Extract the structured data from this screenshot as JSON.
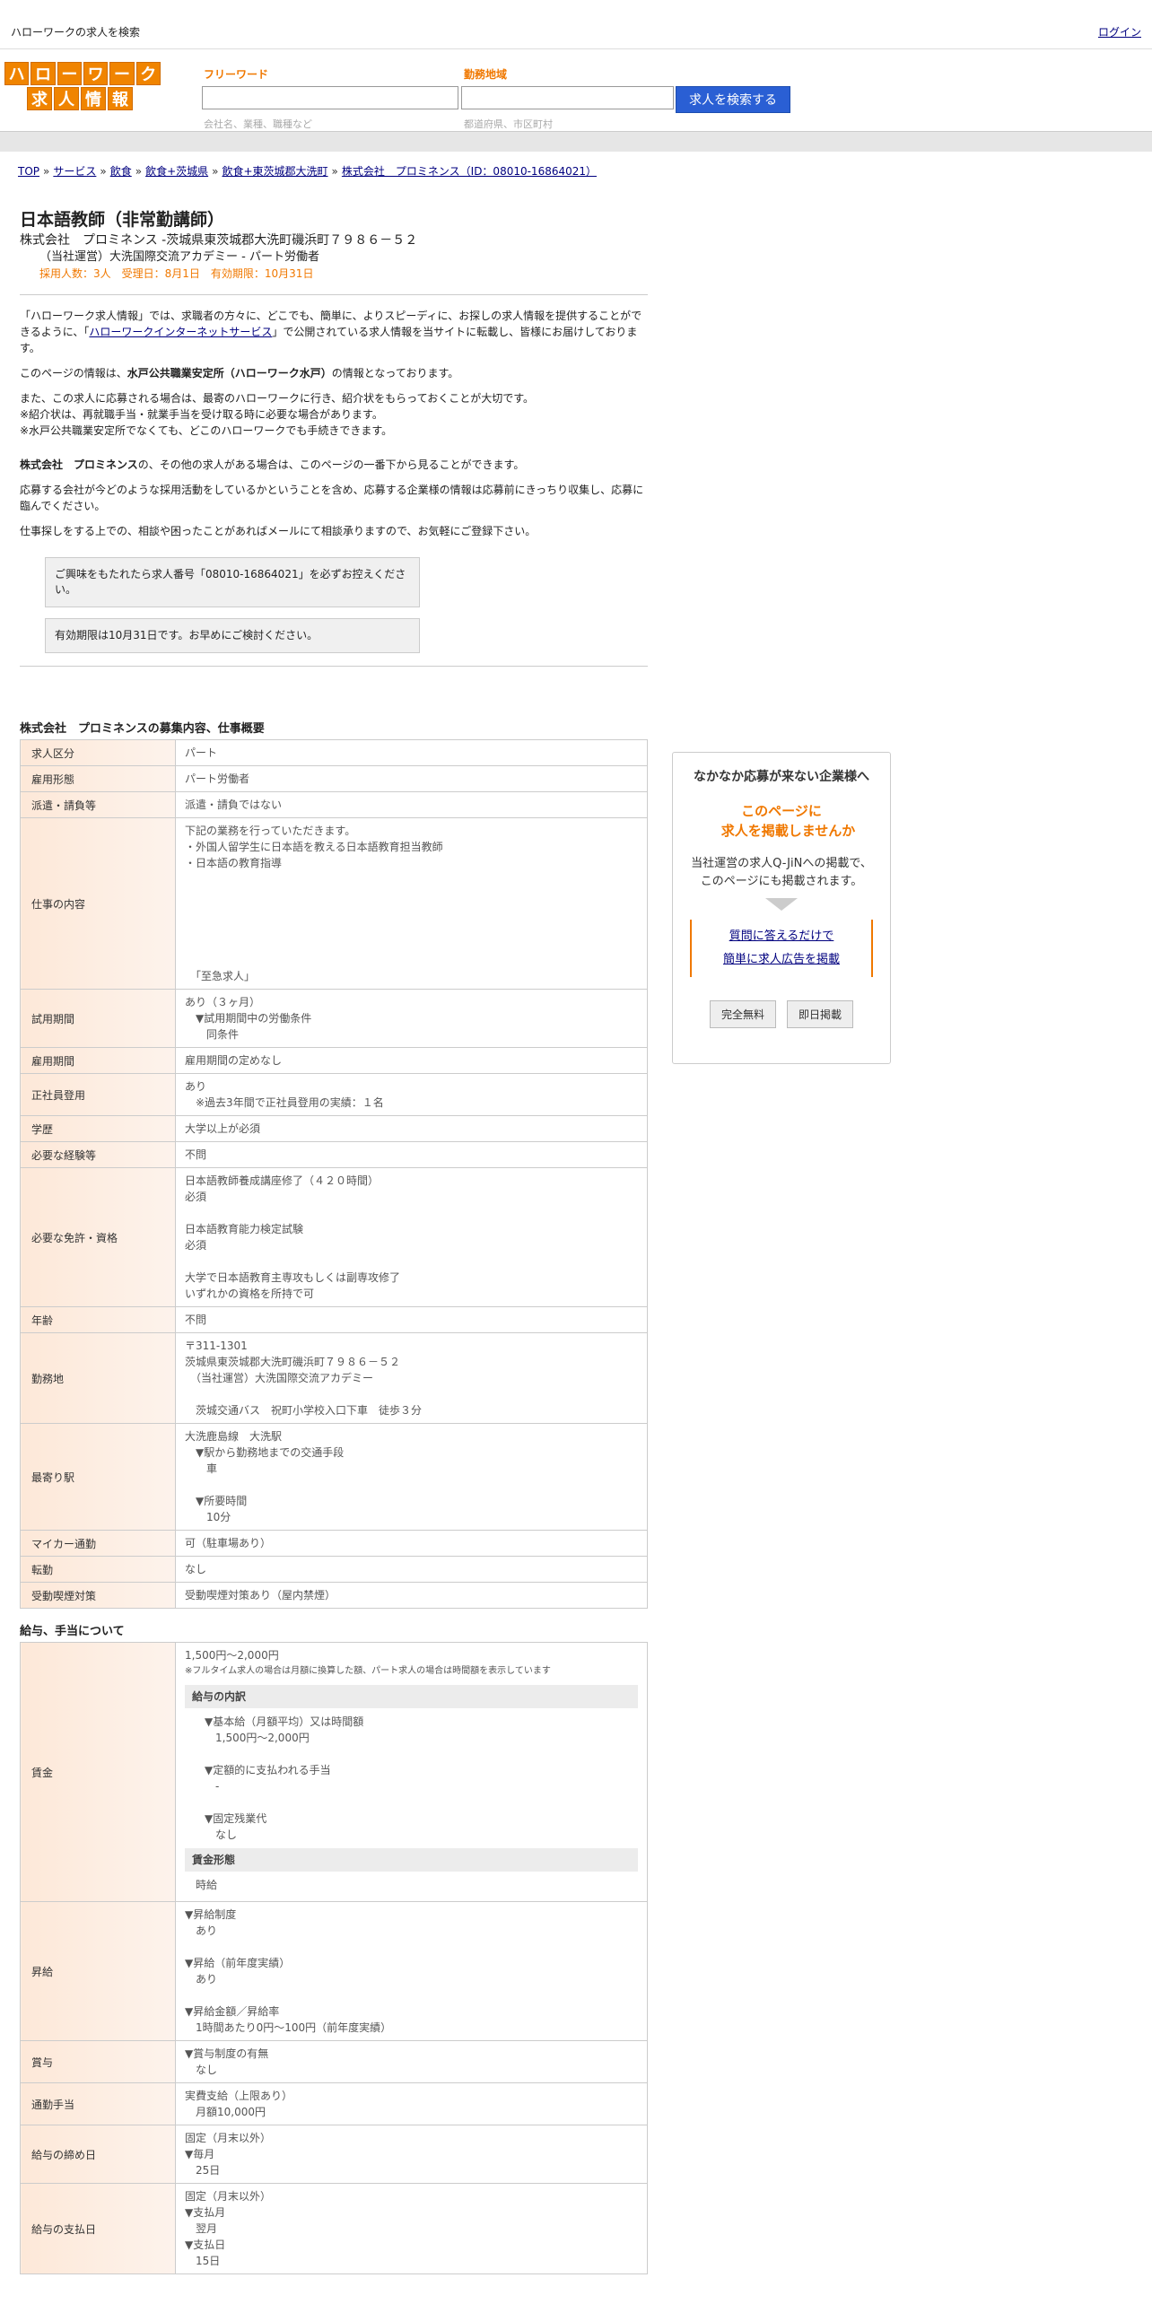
{
  "header": {
    "site_title": "ハローワークの求人を検索",
    "login": "ログイン"
  },
  "logo": {
    "row1": [
      "ハ",
      "ロ",
      "ー",
      "ワ",
      "ー",
      "ク"
    ],
    "row2": [
      "求",
      "人",
      "情",
      "報"
    ]
  },
  "search": {
    "freeword_label": "フリーワード",
    "freeword_placeholder": "会社名、業種、職種など",
    "area_label": "勤務地域",
    "area_placeholder": "都道府県、市区町村",
    "button": "求人を検索する"
  },
  "breadcrumb": [
    "TOP",
    "サービス",
    "飲食",
    "飲食+茨城県",
    "飲食+東茨城郡大洗町",
    "株式会社　プロミネンス（ID：08010-16864021）"
  ],
  "job": {
    "title": "日本語教師（非常勤講師）",
    "company_line": "株式会社　プロミネンス -茨城県東茨城郡大洗町磯浜町７９８６－５２",
    "sub_line": "（当社運営）大洗国際交流アカデミー - パート労働者",
    "meta_line": "採用人数：3人　受理日：8月1日　有効期限：10月31日"
  },
  "intro": {
    "p1": "「ハローワーク求人情報」では、求職者の方々に、どこでも、簡単に、よりスピーディに、お探しの求人情報を提供することができるように、「ハローワークインターネットサービス」で公開されている求人情報を当サイトに転載し、皆様にお届けしております。",
    "p2_pre": "このページの情報は、",
    "p2_bold": "水戸公共職業安定所（ハローワーク水戸）",
    "p2_post": "の情報となっております。",
    "p3": "また、この求人に応募される場合は、最寄のハローワークに行き、紹介状をもらっておくことが大切です。\n※紹介状は、再就職手当・就業手当を受け取る時に必要な場合があります。\n※水戸公共職業安定所でなくても、どこのハローワークでも手続きできます。",
    "p4_bold": "株式会社　プロミネンス",
    "p4_post": "の、その他の求人がある場合は、このページの一番下から見ることができます。",
    "p5": "応募する会社が今どのような採用活動をしているかということを含め、応募する企業様の情報は応募前にきっちり収集し、応募に臨んでください。",
    "p6": "仕事探しをする上での、相談や困ったことがあればメールにて相談承りますので、お気軽にご登録下さい。",
    "note1": "ご興味をもたれたら求人番号「08010-16864021」を必ずお控えください。",
    "note2": "有効期限は10月31日です。お早めにご検討ください。"
  },
  "overview": {
    "title": "株式会社　プロミネンスの募集内容、仕事概要",
    "rows": [
      {
        "label": "求人区分",
        "value": "パート"
      },
      {
        "label": "雇用形態",
        "value": "パート労働者"
      },
      {
        "label": "派遣・請負等",
        "value": "派遣・請負ではない"
      },
      {
        "label": "仕事の内容",
        "value": "下記の業務を行っていただきます。\n・外国人留学生に日本語を教える日本語教育担当教師\n・日本語の教育指導\n\n\n\n\n\n\n　「至急求人」"
      },
      {
        "label": "試用期間",
        "value": "あり（３ヶ月）\n　▼試用期間中の労働条件\n　　同条件"
      },
      {
        "label": "雇用期間",
        "value": "雇用期間の定めなし"
      },
      {
        "label": "正社員登用",
        "value": "あり\n　※過去3年間で正社員登用の実績：１名"
      },
      {
        "label": "学歴",
        "value": "大学以上が必須"
      },
      {
        "label": "必要な経験等",
        "value": "不問"
      },
      {
        "label": "必要な免許・資格",
        "value": "日本語教師養成講座修了（４２０時間）\n必須\n\n日本語教育能力検定試験\n必須\n\n大学で日本語教育主専攻もしくは副専攻修了\nいずれかの資格を所持で可"
      },
      {
        "label": "年齢",
        "value": "不問"
      },
      {
        "label": "勤務地",
        "value": "〒311-1301\n茨城県東茨城郡大洗町磯浜町７９８６－５２\n　（当社運営）大洗国際交流アカデミー\n\n　茨城交通バス　祝町小学校入口下車　徒歩３分"
      },
      {
        "label": "最寄り駅",
        "value": "大洗鹿島線　大洗駅\n　▼駅から勤務地までの交通手段\n　　車\n\n　▼所要時間\n　　10分"
      },
      {
        "label": "マイカー通勤",
        "value": "可（駐車場あり）"
      },
      {
        "label": "転勤",
        "value": "なし"
      },
      {
        "label": "受動喫煙対策",
        "value": "受動喫煙対策あり（屋内禁煙）"
      }
    ]
  },
  "salary": {
    "title": "給与、手当について",
    "wage_label": "賃金",
    "wage_range": "1,500円〜2,000円",
    "wage_note": "※フルタイム求人の場合は月額に換算した額、パート求人の場合は時間額を表示しています",
    "breakdown_head": "給与の内訳",
    "breakdown": "▼基本給（月額平均）又は時間額\n　1,500円〜2,000円\n\n▼定額的に支払われる手当\n　-\n\n▼固定残業代\n　なし",
    "wage_type_head": "賃金形態",
    "wage_type": "時給",
    "rows": [
      {
        "label": "昇給",
        "value": "▼昇給制度\n　あり\n\n▼昇給（前年度実績）\n　あり\n\n▼昇給金額／昇給率\n　1時間あたり0円〜100円（前年度実績）"
      },
      {
        "label": "賞与",
        "value": "▼賞与制度の有無\n　なし"
      },
      {
        "label": "通勤手当",
        "value": "実費支給（上限あり）\n　月額10,000円"
      },
      {
        "label": "給与の締め日",
        "value": "固定（月末以外）\n▼毎月\n　25日"
      },
      {
        "label": "給与の支払日",
        "value": "固定（月末以外）\n▼支払月\n　翌月\n▼支払日\n　15日"
      }
    ]
  },
  "side_ad": {
    "title": "なかなか応募が来ない企業様へ",
    "highlight": "このページに\n　求人を掲載しませんか",
    "desc": "当社運営の求人Q-JiNへの掲載で、\nこのページにも掲載されます。",
    "link1": "質問に答えるだけで",
    "link2": "簡単に求人広告を掲載",
    "btn1": "完全無料",
    "btn2": "即日掲載"
  }
}
